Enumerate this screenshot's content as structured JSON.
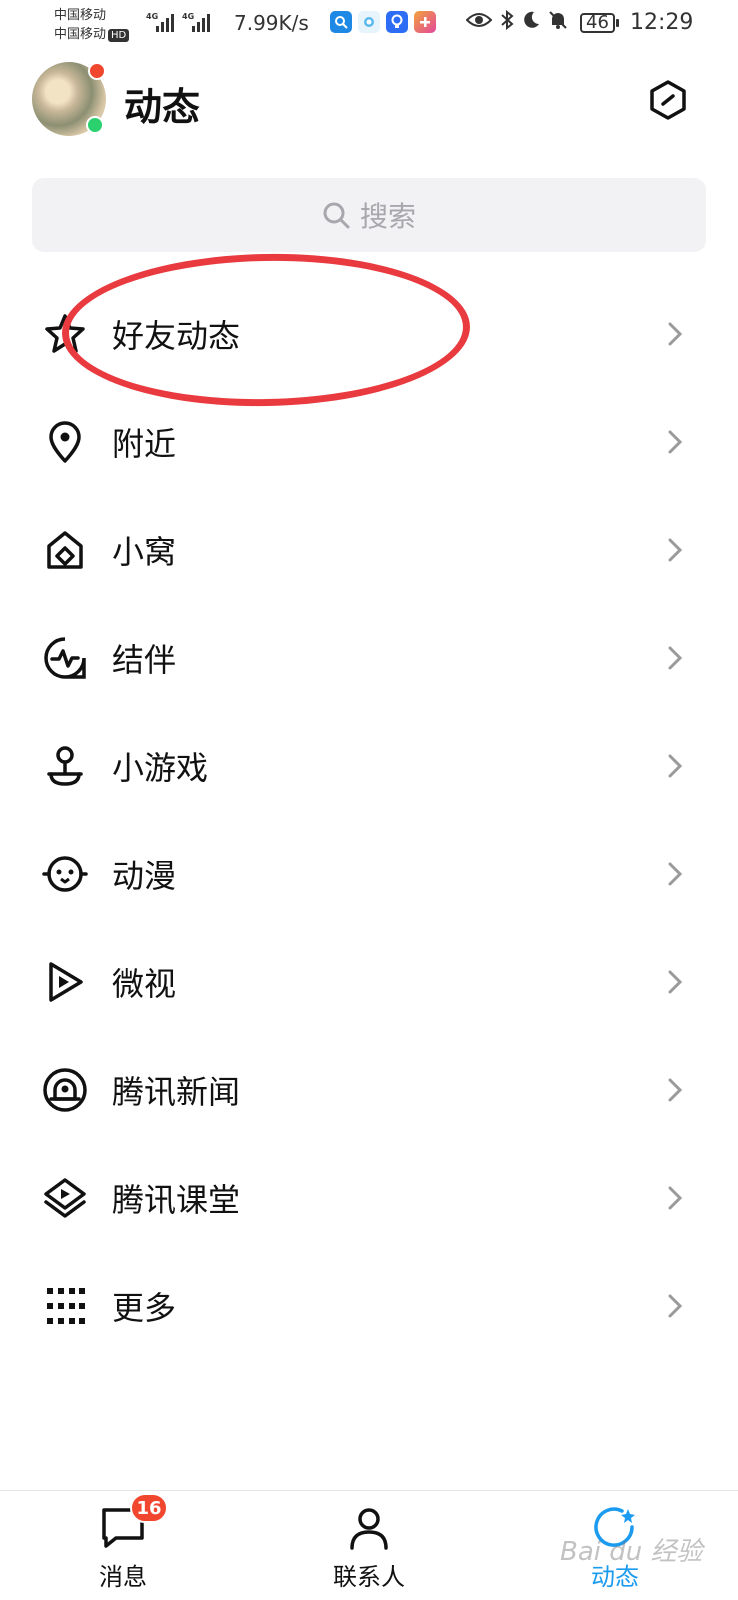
{
  "status_bar": {
    "carrier_1": "中国移动",
    "carrier_2": "中国移动",
    "hd": "HD",
    "network_1": "4G",
    "network_2": "4G",
    "speed": "7.99K/s",
    "battery": "46",
    "time": "12:29",
    "app_icons": [
      {
        "icon": "search-app-icon",
        "color": "#1e88e5"
      },
      {
        "icon": "cloud-app-icon",
        "color": "#7ec8f0"
      },
      {
        "icon": "bulb-app-icon",
        "color": "#2d6df6"
      },
      {
        "icon": "plus-app-icon",
        "color": "#f26b5b"
      }
    ]
  },
  "header": {
    "title": "动态"
  },
  "search": {
    "placeholder": "搜索"
  },
  "menu": {
    "items": [
      {
        "label": "好友动态",
        "icon": "star-icon"
      },
      {
        "label": "附近",
        "icon": "location-pin-icon"
      },
      {
        "label": "小窝",
        "icon": "house-icon"
      },
      {
        "label": "结伴",
        "icon": "pulse-icon"
      },
      {
        "label": "小游戏",
        "icon": "joystick-icon"
      },
      {
        "label": "动漫",
        "icon": "penguin-face-icon"
      },
      {
        "label": "微视",
        "icon": "play-icon"
      },
      {
        "label": "腾讯新闻",
        "icon": "news-bell-icon"
      },
      {
        "label": "腾讯课堂",
        "icon": "classroom-icon"
      },
      {
        "label": "更多",
        "icon": "grid-dots-icon"
      }
    ]
  },
  "bottom_nav": {
    "tabs": [
      {
        "label": "消息",
        "badge": "16",
        "icon": "chat-bubble-icon"
      },
      {
        "label": "联系人",
        "icon": "person-icon"
      },
      {
        "label": "动态",
        "icon": "star-orbit-icon",
        "active": true
      }
    ]
  },
  "watermark": "Bai du 经验",
  "colors": {
    "accent": "#1b9bf0",
    "badge": "#f2472f",
    "online": "#2bd16f",
    "annotation": "#e93b3f"
  }
}
